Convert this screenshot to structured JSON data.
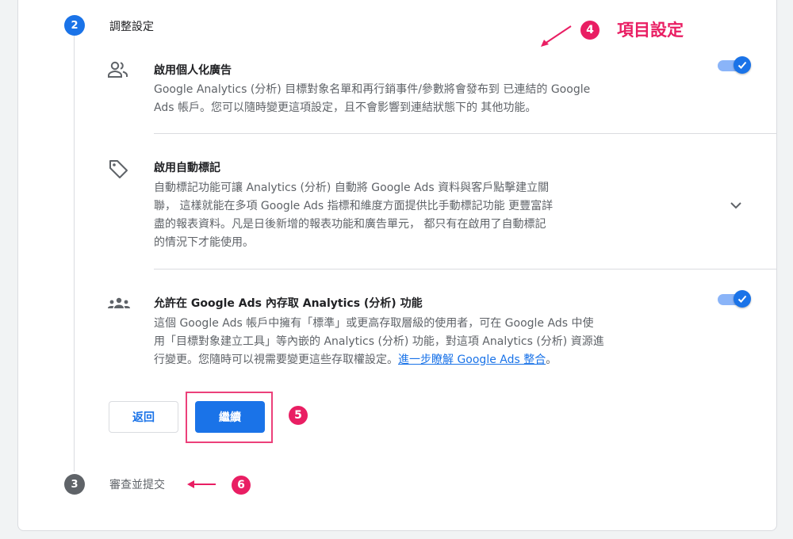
{
  "steps": {
    "current": {
      "number": "2",
      "label": "調整設定"
    },
    "next": {
      "number": "3",
      "label": "審查並提交"
    }
  },
  "sections": [
    {
      "icon": "people-icon",
      "title": "啟用個人化廣告",
      "description_lines": [
        "Google Analytics (分析) 目標對象名單和再行銷事件/參數將會發布到 已連結的 Google",
        "Ads 帳戶。您可以隨時變更這項設定，且不會影響到連結狀態下的 其他功能。"
      ],
      "toggle_on": true
    },
    {
      "icon": "tag-icon",
      "title": "啟用自動標記",
      "description_lines": [
        "自動標記功能可讓 Analytics (分析) 自動將 Google Ads 資料與客戶點擊建立關",
        "聯， 這樣就能在多項 Google Ads 指標和維度方面提供比手動標記功能 更豐富詳",
        "盡的報表資料。凡是日後新增的報表功能和廣告單元， 都只有在啟用了自動標記",
        "的情況下才能使用。"
      ],
      "expandable": true
    },
    {
      "icon": "group-icon",
      "title": "允許在 Google Ads 內存取 Analytics (分析) 功能",
      "description_lines": [
        "這個 Google Ads 帳戶中擁有「標準」或更高存取層級的使用者，可在 Google Ads 中使",
        "用「目標對象建立工具」等內嵌的 Analytics (分析) 功能，對這項 Analytics (分析) 資源進",
        "行變更。您隨時可以視需要變更這些存取權設定。"
      ],
      "link_text": "進一步瞭解 Google Ads 整合",
      "link_suffix": "。",
      "toggle_on": true
    }
  ],
  "buttons": {
    "back": "返回",
    "continue": "繼續"
  },
  "annotations": {
    "a4": {
      "number": "4",
      "text": "項目設定"
    },
    "a5": {
      "number": "5"
    },
    "a6": {
      "number": "6"
    }
  },
  "colors": {
    "primary": "#1a73e8",
    "annotation": "#e91e63",
    "step_inactive": "#5f6368"
  }
}
